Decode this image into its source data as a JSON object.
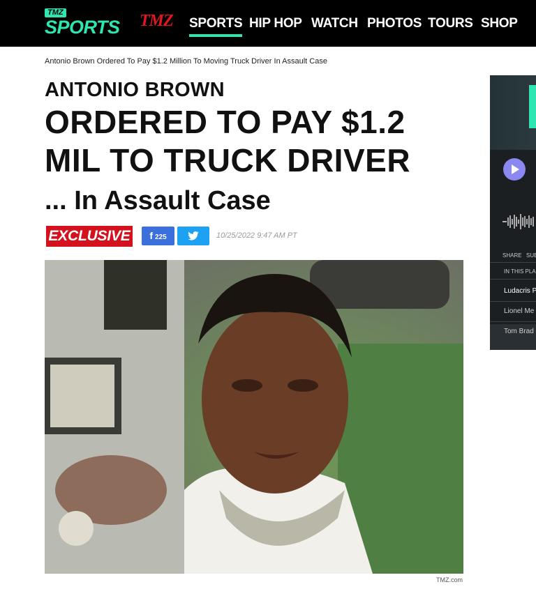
{
  "nav": {
    "logo_badge": "TMZ",
    "logo_text": "SPORTS",
    "brand": "TMZ",
    "items": [
      {
        "label": "SPORTS",
        "active": true
      },
      {
        "label": "HIP HOP",
        "active": false
      },
      {
        "label": "WATCH",
        "active": false
      },
      {
        "label": "PHOTOS",
        "active": false
      },
      {
        "label": "TOURS",
        "active": false
      },
      {
        "label": "SHOP",
        "active": false
      }
    ]
  },
  "breadcrumb": "Antonio Brown Ordered To Pay $1.2 Million To Moving Truck Driver In Assault Case",
  "article": {
    "kicker": "ANTONIO BROWN",
    "headline": "ORDERED TO PAY $1.2 MIL TO TRUCK DRIVER",
    "subhead": "... In Assault Case",
    "badge": "EXCLUSIVE",
    "facebook_count": "225",
    "timestamp": "10/25/2022 9:47 AM PT",
    "image_credit": "TMZ.com"
  },
  "sidebar": {
    "share_label": "SHARE",
    "subscribe_label": "SUB",
    "playlist_label": "IN THIS PLA",
    "items": [
      "Ludacris P",
      "Lionel Me",
      "Tom Brad"
    ]
  },
  "colors": {
    "accent": "#2de6b0",
    "brand_red": "#e4161d",
    "exclusive_red": "#d3121d",
    "facebook": "#3a6fdc",
    "twitter": "#1da1f2",
    "play": "#8b88f2"
  },
  "icons": [
    "facebook-icon",
    "twitter-bird-icon",
    "play-icon",
    "waveform-icon"
  ]
}
